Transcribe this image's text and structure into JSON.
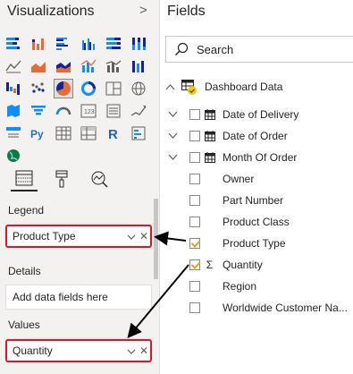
{
  "viz_pane": {
    "title": "Visualizations",
    "collapse_icon": "chevron-right-icon",
    "icons": [
      "stacked-bar-icon",
      "stacked-column-icon",
      "clustered-bar-icon",
      "clustered-column-icon",
      "100-bar-icon",
      "100-column-icon",
      "line-chart-icon",
      "area-chart-icon",
      "stacked-area-icon",
      "line-column-icon",
      "line-stacked-column-icon",
      "ribbon-chart-icon",
      "waterfall-icon",
      "scatter-chart-icon",
      "pie-chart-icon",
      "donut-chart-icon",
      "treemap-icon",
      "map-icon",
      "filled-map-icon",
      "funnel-icon",
      "gauge-icon",
      "card-icon",
      "multi-row-card-icon",
      "kpi-icon",
      "slicer-icon",
      "python-visual-icon",
      "table-icon",
      "matrix-icon",
      "r-visual-icon",
      "key-influencers-icon",
      "globe-icon"
    ],
    "python_label": "Py",
    "r_label": "R",
    "selected_icon": "pie-chart-icon",
    "field_tabs": [
      "fields-tab-icon",
      "format-paint-icon",
      "analytics-icon"
    ],
    "wells": {
      "legend": {
        "label": "Legend",
        "field": "Product Type"
      },
      "details": {
        "label": "Details",
        "placeholder": "Add data fields here"
      },
      "values": {
        "label": "Values",
        "field": "Quantity"
      }
    }
  },
  "fields_pane": {
    "title": "Fields",
    "search_placeholder": "Search",
    "table": {
      "name": "Dashboard Data"
    },
    "fields": [
      {
        "name": "Date of Delivery",
        "type": "date",
        "checked": false,
        "expandable": true
      },
      {
        "name": "Date of Order",
        "type": "date",
        "checked": false,
        "expandable": true
      },
      {
        "name": "Month Of Order",
        "type": "date",
        "checked": false,
        "expandable": true
      },
      {
        "name": "Owner",
        "type": "text",
        "checked": false,
        "expandable": false
      },
      {
        "name": "Part Number",
        "type": "text",
        "checked": false,
        "expandable": false
      },
      {
        "name": "Product Class",
        "type": "text",
        "checked": false,
        "expandable": false
      },
      {
        "name": "Product Type",
        "type": "text",
        "checked": true,
        "expandable": false
      },
      {
        "name": "Quantity",
        "type": "sum",
        "checked": true,
        "expandable": false
      },
      {
        "name": "Region",
        "type": "text",
        "checked": false,
        "expandable": false
      },
      {
        "name": "Worldwide Customer Na...",
        "type": "text",
        "checked": false,
        "expandable": false
      }
    ],
    "sigma": "Σ"
  },
  "colors": {
    "highlight_border": "#e81123",
    "check_accent": "#e8a20c",
    "pane_background": "#f3f2f1",
    "chart_blue": "#118dff",
    "chart_orange": "#e66c37",
    "chart_navy": "#12239e"
  }
}
